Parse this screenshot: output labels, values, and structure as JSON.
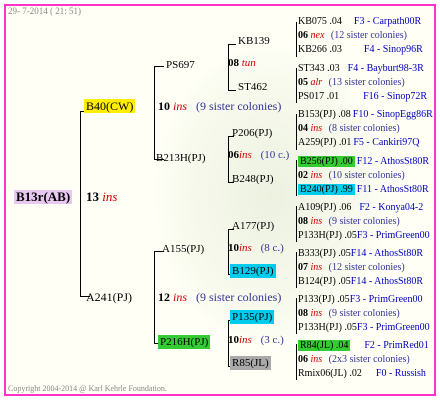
{
  "header": {
    "date": "29- 7-2014 ( 21: 51)"
  },
  "footer": {
    "copyright": "Copyright 2004-2014 @ Karl Kehrle Foundation."
  },
  "colors": {
    "border": "#ff33cc",
    "root_bg": "#e8c8f0",
    "yellow": "#ffee00",
    "green": "#33cc33",
    "cyan": "#00ccee",
    "gray": "#aaaaaa"
  },
  "root": {
    "name": "B13r(AB)",
    "num": "13",
    "tag": "ins"
  },
  "g1": {
    "top": {
      "name": "B40(CW)",
      "num": "10",
      "tag": "ins",
      "sisters": "(9 sister colonies)"
    },
    "bottom": {
      "name": "A241(PJ)",
      "num": "12",
      "tag": "ins",
      "sisters": "(9 sister colonies)"
    }
  },
  "g2": {
    "a": {
      "name": "PS697",
      "num": "08",
      "tag": "tun"
    },
    "b": {
      "name": "B213H(PJ)",
      "num": "06",
      "tag": "ins",
      "sisters": "(10 c.)"
    },
    "c": {
      "name": "A155(PJ)",
      "num": "10",
      "tag": "ins",
      "sisters": "(8 c.)"
    },
    "d": {
      "name": "P216H(PJ)",
      "num": "10",
      "tag": "ins",
      "sisters": "(3 c.)"
    }
  },
  "g3": {
    "a1": "KB139",
    "a2": "ST462",
    "b1": "P206(PJ)",
    "b2": "B248(PJ)",
    "c1": "A177(PJ)",
    "c2": "B129(PJ)",
    "d1": "P135(PJ)",
    "d2": "R85(JL)"
  },
  "g4": [
    {
      "l1": "KB075 .04",
      "l1r": "F3 - Carpath00R",
      "num": "06",
      "tag": "nex",
      "sis": "(12 sister colonies)",
      "l3": "KB266 .03",
      "l3r": "F4 - Sinop96R"
    },
    {
      "l1": "ST343 .03",
      "l1r": "F4 - Bayburt98-3R",
      "num": "05",
      "tag": "alr",
      "sis": "(13 sister colonies)",
      "l3": "PS017 .01",
      "l3r": "F16 - Sinop72R"
    },
    {
      "l1": "B153(PJ) .08",
      "l1r": "F10 - SinopEgg86R",
      "num": "04",
      "tag": "ins",
      "sis": "(8 sister colonies)",
      "l3": "A259(PJ) .01",
      "l3r": "F5 - Cankiri97Q"
    },
    {
      "l1": "B256(PJ) .00",
      "l1r": "F12 - AthosSt80R",
      "num": "02",
      "tag": "ins",
      "sis": "(10 sister colonies)",
      "l3": "B240(PJ) .99",
      "l3r": "F11 - AthosSt80R"
    },
    {
      "l1": "A109(PJ) .06",
      "l1r": "F2 - Konya04-2",
      "num": "08",
      "tag": "ins",
      "sis": "(9 sister colonies)",
      "l3": "P133H(PJ) .05",
      "l3r": "F3 - PrimGreen00"
    },
    {
      "l1": "B333(PJ) .05",
      "l1r": "F14 - AthosSt80R",
      "num": "07",
      "tag": "ins",
      "sis": "(12 sister colonies)",
      "l3": "B124(PJ) .05",
      "l3r": "F14 - AthosSt80R"
    },
    {
      "l1": "P133(PJ) .05",
      "l1r": "F3 - PrimGreen00",
      "num": "08",
      "tag": "ins",
      "sis": "(9 sister colonies)",
      "l3": "P133H(PJ) .05",
      "l3r": "F3 - PrimGreen00"
    },
    {
      "l1": "R84(JL) .04",
      "l1r": "F2 - PrimRed01",
      "num": "06",
      "tag": "ins",
      "sis": "(2x3 sister colonies)",
      "l3": "Rmix06(JL) .02",
      "l3r": "F0 - Russish"
    }
  ]
}
